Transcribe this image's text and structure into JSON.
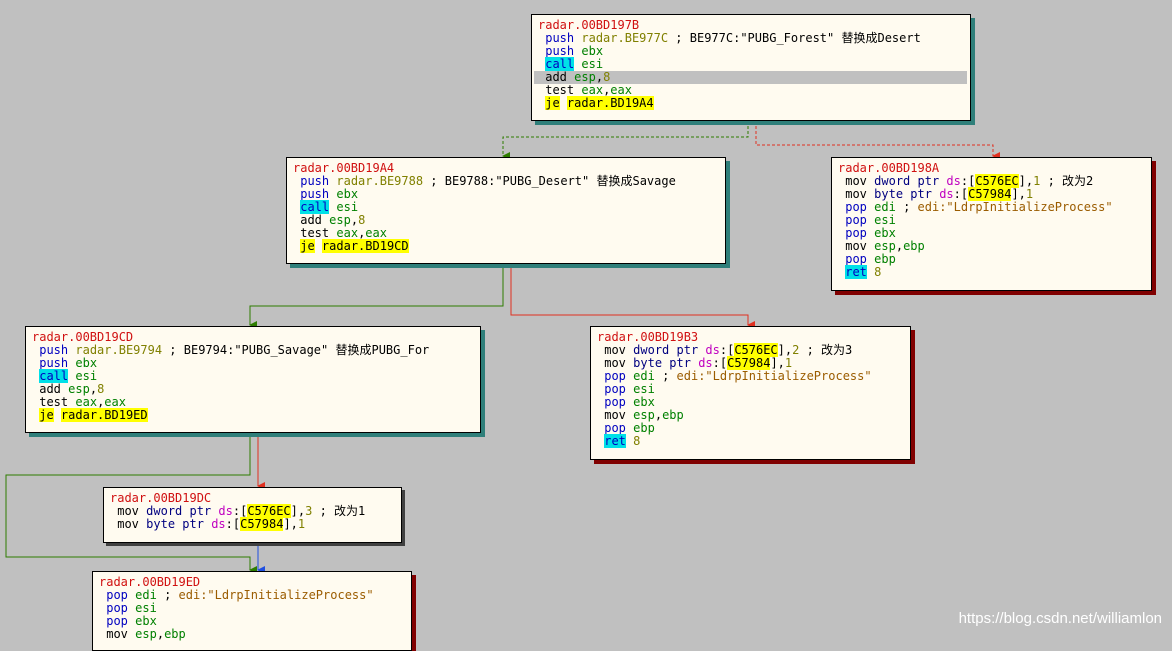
{
  "blocks": [
    {
      "id": "b197b",
      "label": "radar.00BD197B",
      "shadow": "teal",
      "lines": [
        {
          "i": "push",
          "o": [
            [
              "sym",
              "radar.BE977C"
            ]
          ],
          "c": [
            [
              "cmt",
              " ; BE977C:\"PUBG_Forest\" 替换成Desert"
            ]
          ]
        },
        {
          "i": "push",
          "o": [
            [
              "reg",
              "ebx"
            ]
          ]
        },
        {
          "i": "call",
          "o": [
            [
              "reg",
              "esi"
            ]
          ],
          "hl": "call"
        },
        {
          "i": "add",
          "o": [
            [
              "reg",
              "esp"
            ],
            [
              "cmt",
              ","
            ],
            [
              "num",
              "8"
            ]
          ],
          "sel": true
        },
        {
          "i": "test",
          "o": [
            [
              "reg",
              "eax"
            ],
            [
              "cmt",
              ","
            ],
            [
              "reg",
              "eax"
            ]
          ]
        },
        {
          "i": "je",
          "o": [
            [
              "dst",
              "radar.BD19A4"
            ]
          ],
          "hl": "je"
        }
      ]
    },
    {
      "id": "b19a4",
      "label": "radar.00BD19A4",
      "shadow": "teal",
      "lines": [
        {
          "i": "push",
          "o": [
            [
              "sym",
              "radar.BE9788"
            ]
          ],
          "c": [
            [
              "cmt",
              " ; BE9788:\"PUBG_Desert\" 替换成Savage"
            ]
          ]
        },
        {
          "i": "push",
          "o": [
            [
              "reg",
              "ebx"
            ]
          ]
        },
        {
          "i": "call",
          "o": [
            [
              "reg",
              "esi"
            ]
          ],
          "hl": "call"
        },
        {
          "i": "add",
          "o": [
            [
              "reg",
              "esp"
            ],
            [
              "cmt",
              ","
            ],
            [
              "num",
              "8"
            ]
          ]
        },
        {
          "i": "test",
          "o": [
            [
              "reg",
              "eax"
            ],
            [
              "cmt",
              ","
            ],
            [
              "reg",
              "eax"
            ]
          ]
        },
        {
          "i": "je",
          "o": [
            [
              "dst",
              "radar.BD19CD"
            ]
          ],
          "hl": "je"
        }
      ]
    },
    {
      "id": "b198a",
      "label": "radar.00BD198A",
      "shadow": "red",
      "lines": [
        {
          "i": "mov",
          "o": [
            [
              "ptr",
              "dword ptr "
            ],
            [
              "seg",
              "ds"
            ],
            [
              "cmt",
              ":["
            ],
            [
              "dst",
              "C576EC"
            ],
            [
              "cmt",
              "],"
            ],
            [
              "num",
              "1"
            ]
          ],
          "c": [
            [
              "cmt",
              " ; 改为2"
            ]
          ]
        },
        {
          "i": "mov",
          "o": [
            [
              "ptr",
              "byte ptr "
            ],
            [
              "seg",
              "ds"
            ],
            [
              "cmt",
              ":["
            ],
            [
              "dst",
              "C57984"
            ],
            [
              "cmt",
              "],"
            ],
            [
              "num",
              "1"
            ]
          ]
        },
        {
          "i": "pop",
          "o": [
            [
              "reg",
              "edi"
            ]
          ],
          "c": [
            [
              "cmt",
              " ; "
            ],
            [
              "str",
              "edi:\"LdrpInitializeProcess\""
            ]
          ]
        },
        {
          "i": "pop",
          "o": [
            [
              "reg",
              "esi"
            ]
          ]
        },
        {
          "i": "pop",
          "o": [
            [
              "reg",
              "ebx"
            ]
          ]
        },
        {
          "i": "mov",
          "o": [
            [
              "reg",
              "esp"
            ],
            [
              "cmt",
              ","
            ],
            [
              "reg",
              "ebp"
            ]
          ]
        },
        {
          "i": "pop",
          "o": [
            [
              "reg",
              "ebp"
            ]
          ]
        },
        {
          "i": "ret",
          "o": [
            [
              "num",
              "8"
            ]
          ],
          "hl": "ret"
        }
      ]
    },
    {
      "id": "b19cd",
      "label": "radar.00BD19CD",
      "shadow": "teal",
      "lines": [
        {
          "i": "push",
          "o": [
            [
              "sym",
              "radar.BE9794"
            ]
          ],
          "c": [
            [
              "cmt",
              " ; BE9794:\"PUBG_Savage\" 替换成PUBG_For"
            ]
          ]
        },
        {
          "i": "push",
          "o": [
            [
              "reg",
              "ebx"
            ]
          ]
        },
        {
          "i": "call",
          "o": [
            [
              "reg",
              "esi"
            ]
          ],
          "hl": "call"
        },
        {
          "i": "add",
          "o": [
            [
              "reg",
              "esp"
            ],
            [
              "cmt",
              ","
            ],
            [
              "num",
              "8"
            ]
          ]
        },
        {
          "i": "test",
          "o": [
            [
              "reg",
              "eax"
            ],
            [
              "cmt",
              ","
            ],
            [
              "reg",
              "eax"
            ]
          ]
        },
        {
          "i": "je",
          "o": [
            [
              "dst",
              "radar.BD19ED"
            ]
          ],
          "hl": "je"
        }
      ]
    },
    {
      "id": "b19b3",
      "label": "radar.00BD19B3",
      "shadow": "red",
      "lines": [
        {
          "i": "mov",
          "o": [
            [
              "ptr",
              "dword ptr "
            ],
            [
              "seg",
              "ds"
            ],
            [
              "cmt",
              ":["
            ],
            [
              "dst",
              "C576EC"
            ],
            [
              "cmt",
              "],"
            ],
            [
              "num",
              "2"
            ]
          ],
          "c": [
            [
              "cmt",
              " ; 改为3"
            ]
          ]
        },
        {
          "i": "mov",
          "o": [
            [
              "ptr",
              "byte ptr "
            ],
            [
              "seg",
              "ds"
            ],
            [
              "cmt",
              ":["
            ],
            [
              "dst",
              "C57984"
            ],
            [
              "cmt",
              "],"
            ],
            [
              "num",
              "1"
            ]
          ]
        },
        {
          "i": "pop",
          "o": [
            [
              "reg",
              "edi"
            ]
          ],
          "c": [
            [
              "cmt",
              " ; "
            ],
            [
              "str",
              "edi:\"LdrpInitializeProcess\""
            ]
          ]
        },
        {
          "i": "pop",
          "o": [
            [
              "reg",
              "esi"
            ]
          ]
        },
        {
          "i": "pop",
          "o": [
            [
              "reg",
              "ebx"
            ]
          ]
        },
        {
          "i": "mov",
          "o": [
            [
              "reg",
              "esp"
            ],
            [
              "cmt",
              ","
            ],
            [
              "reg",
              "ebp"
            ]
          ]
        },
        {
          "i": "pop",
          "o": [
            [
              "reg",
              "ebp"
            ]
          ]
        },
        {
          "i": "ret",
          "o": [
            [
              "num",
              "8"
            ]
          ],
          "hl": "ret"
        }
      ]
    },
    {
      "id": "b19dc",
      "label": "radar.00BD19DC",
      "shadow": "none",
      "lines": [
        {
          "i": "mov",
          "o": [
            [
              "ptr",
              "dword ptr "
            ],
            [
              "seg",
              "ds"
            ],
            [
              "cmt",
              ":["
            ],
            [
              "dst",
              "C576EC"
            ],
            [
              "cmt",
              "],"
            ],
            [
              "num",
              "3"
            ]
          ],
          "c": [
            [
              "cmt",
              " ; 改为1"
            ]
          ]
        },
        {
          "i": "mov",
          "o": [
            [
              "ptr",
              "byte ptr "
            ],
            [
              "seg",
              "ds"
            ],
            [
              "cmt",
              ":["
            ],
            [
              "dst",
              "C57984"
            ],
            [
              "cmt",
              "],"
            ],
            [
              "num",
              "1"
            ]
          ]
        }
      ]
    },
    {
      "id": "b19ed",
      "label": "radar.00BD19ED",
      "shadow": "red",
      "lines": [
        {
          "i": "pop",
          "o": [
            [
              "reg",
              "edi"
            ]
          ],
          "c": [
            [
              "cmt",
              " ; "
            ],
            [
              "str",
              "edi:\"LdrpInitializeProcess\""
            ]
          ]
        },
        {
          "i": "pop",
          "o": [
            [
              "reg",
              "esi"
            ]
          ]
        },
        {
          "i": "pop",
          "o": [
            [
              "reg",
              "ebx"
            ]
          ]
        },
        {
          "i": "mov",
          "o": [
            [
              "reg",
              "esp"
            ],
            [
              "cmt",
              ","
            ],
            [
              "reg",
              "ebp"
            ]
          ]
        }
      ]
    }
  ],
  "colors": {
    "taken": "#2e7d00",
    "fallthrough": "#e03020",
    "unconditional": "#1f4fe0"
  },
  "watermark": "https://blog.csdn.net/williamlon"
}
